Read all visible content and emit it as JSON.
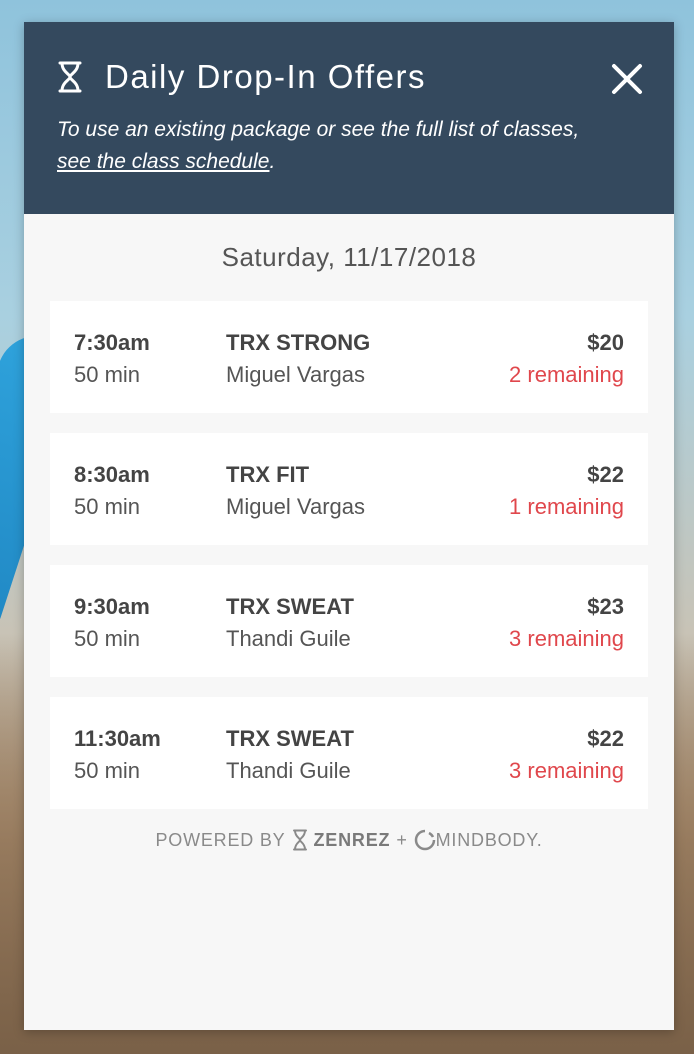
{
  "header": {
    "title": "Daily Drop-In Offers",
    "subtitle_prefix": "To use an existing package or see the full list of classes, ",
    "subtitle_link": "see the class schedule",
    "subtitle_suffix": "."
  },
  "date": "Saturday, 11/17/2018",
  "classes": [
    {
      "time": "7:30am",
      "duration": "50 min",
      "name": "TRX STRONG",
      "instructor": "Miguel Vargas",
      "price": "$20",
      "remaining": "2 remaining"
    },
    {
      "time": "8:30am",
      "duration": "50 min",
      "name": "TRX FIT",
      "instructor": "Miguel Vargas",
      "price": "$22",
      "remaining": "1 remaining"
    },
    {
      "time": "9:30am",
      "duration": "50 min",
      "name": "TRX SWEAT",
      "instructor": "Thandi Guile",
      "price": "$23",
      "remaining": "3 remaining"
    },
    {
      "time": "11:30am",
      "duration": "50 min",
      "name": "TRX SWEAT",
      "instructor": "Thandi Guile",
      "price": "$22",
      "remaining": "3 remaining"
    }
  ],
  "footer": {
    "powered_by": "POWERED BY",
    "brand1": "ZENREZ",
    "plus": "+",
    "brand2": "MINDBODY."
  },
  "colors": {
    "header_bg": "#34495e",
    "remaining": "#e0474c"
  },
  "icons": {
    "header": "hourglass-icon",
    "close": "close-icon",
    "zenrez": "hourglass-icon",
    "mindbody": "mindbody-logo-icon"
  }
}
